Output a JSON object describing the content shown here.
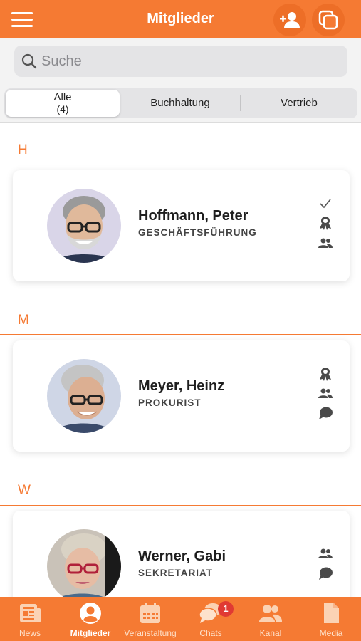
{
  "header": {
    "title": "Mitglieder"
  },
  "search": {
    "placeholder": "Suche"
  },
  "tabs": [
    {
      "label": "Alle",
      "count": "(4)",
      "active": true
    },
    {
      "label": "Buchhaltung"
    },
    {
      "label": "Vertrieb"
    }
  ],
  "sections": [
    {
      "letter": "H",
      "member": {
        "name": "Hoffmann, Peter",
        "role": "GESCHÄFTSFÜHRUNG",
        "icons": [
          "check-icon",
          "award-icon",
          "group-icon"
        ]
      }
    },
    {
      "letter": "M",
      "member": {
        "name": "Meyer, Heinz",
        "role": "PROKURIST",
        "icons": [
          "award-icon",
          "group-icon",
          "chat-icon"
        ]
      }
    },
    {
      "letter": "W",
      "member": {
        "name": "Werner, Gabi",
        "role": "SEKRETARIAT",
        "icons": [
          "group-icon",
          "chat-icon"
        ]
      }
    }
  ],
  "nav": [
    {
      "label": "News",
      "icon": "news-icon"
    },
    {
      "label": "Mitglieder",
      "icon": "member-icon",
      "active": true
    },
    {
      "label": "Veranstaltung",
      "icon": "calendar-icon"
    },
    {
      "label": "Chats",
      "icon": "chats-icon",
      "badge": "1"
    },
    {
      "label": "Kanal",
      "icon": "channel-icon"
    },
    {
      "label": "Media",
      "icon": "media-icon"
    }
  ],
  "colors": {
    "accent": "#f57a33",
    "badge": "#e03a33"
  }
}
